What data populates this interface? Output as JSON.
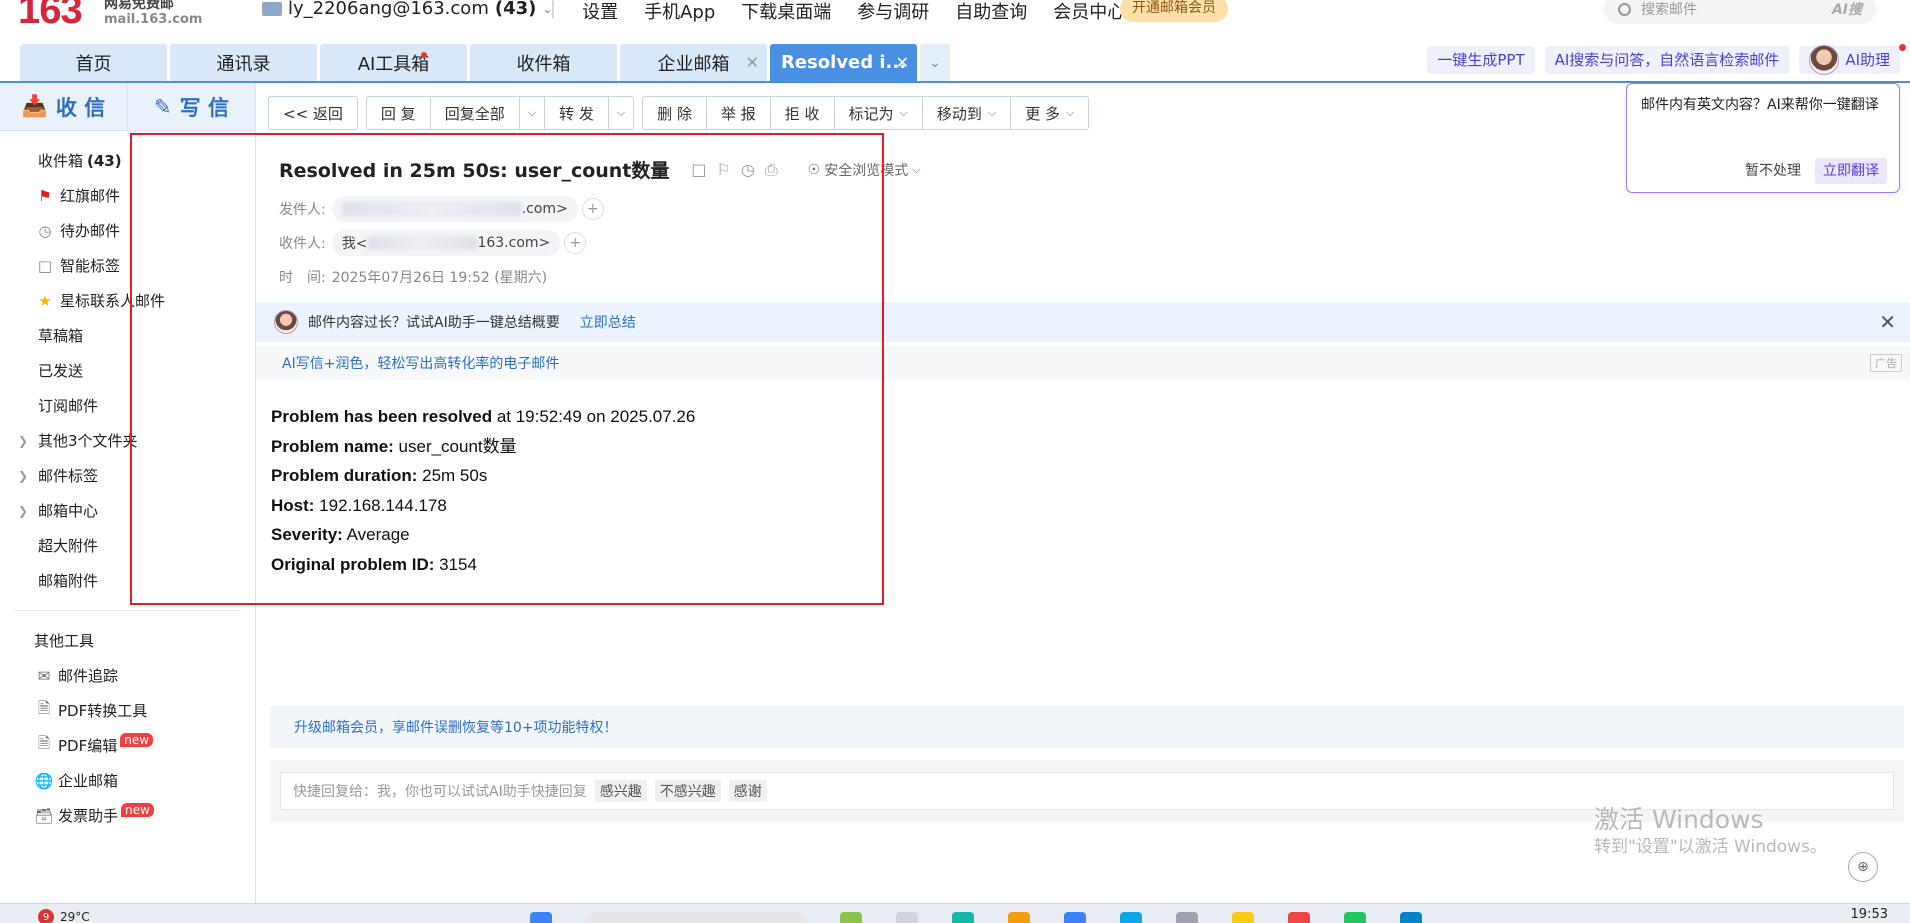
{
  "header": {
    "logo_number": "163",
    "logo_brand": "网易免费邮",
    "logo_domain": "mail.163.com",
    "account": "ly_2206ang@163.com",
    "account_count": "(43)",
    "nav": [
      "设置",
      "手机App",
      "下载桌面端",
      "参与调研",
      "自助查询",
      "会员中心"
    ],
    "vip_button": "开通邮箱会员",
    "search_placeholder": "搜索邮件",
    "search_ai": "AI搜"
  },
  "tabs": [
    {
      "label": "首页"
    },
    {
      "label": "通讯录"
    },
    {
      "label": "AI工具箱"
    },
    {
      "label": "收件箱"
    },
    {
      "label": "企业邮箱"
    },
    {
      "label": "Resolved i..."
    }
  ],
  "right_pills": [
    "一键生成PPT",
    "AI搜索与问答，自然语言检索邮件"
  ],
  "ai_helper_label": "AI助理",
  "sidebar": {
    "receive": "收 信",
    "write": "写 信",
    "inbox_label": "收件箱",
    "inbox_count": "(43)",
    "items": [
      "红旗邮件",
      "待办邮件",
      "智能标签",
      "星标联系人邮件",
      "草稿箱",
      "已发送",
      "订阅邮件",
      "其他3个文件夹",
      "邮件标签",
      "邮箱中心",
      "超大附件",
      "邮箱附件"
    ],
    "tools_title": "其他工具",
    "tools": [
      "邮件追踪",
      "PDF转换工具",
      "PDF编辑",
      "企业邮箱",
      "发票助手"
    ],
    "new_badge": "new"
  },
  "toolbar": {
    "back": "<< 返回",
    "reply": "回 复",
    "reply_all": "回复全部",
    "forward": "转 发",
    "delete": "删 除",
    "report": "举 报",
    "reject": "拒 收",
    "mark_as": "标记为",
    "move_to": "移动到",
    "more": "更 多"
  },
  "mail": {
    "subject": "Resolved in 25m 50s: user_count数量",
    "safe_mode": "安全浏览模式",
    "from_label": "发件人:",
    "from_suffix": ".com>",
    "to_label": "收件人:",
    "to_prefix": "我<",
    "to_suffix": "163.com>",
    "time_label": "时　间:",
    "time_value": "2025年07月26日 19:52 (星期六)",
    "ai_summary_prompt": "邮件内容过长？试试AI助手一键总结概要",
    "ai_summary_link": "立即总结",
    "ad_text": "AI写信+润色，轻松写出高转化率的电子邮件",
    "ad_tag": "广告",
    "body": {
      "line1_bold": "Problem has been resolved",
      "line1_rest": " at 19:52:49 on 2025.07.26",
      "line2_bold": "Problem name:",
      "line2_rest": " user_count数量",
      "line3_bold": "Problem duration:",
      "line3_rest": " 25m 50s",
      "line4_bold": "Host:",
      "line4_rest": " 192.168.144.178",
      "line5_bold": "Severity:",
      "line5_rest": " Average",
      "line6_bold": "Original problem ID:",
      "line6_rest": " 3154"
    }
  },
  "upgrade_text": "升级邮箱会员，享邮件误删恢复等10+项功能特权！",
  "quick_reply": {
    "placeholder": "快捷回复给：我，你也可以试试AI助手快捷回复",
    "chips": [
      "感兴趣",
      "不感兴趣",
      "感谢"
    ]
  },
  "translate_popup": {
    "text": "邮件内有英文内容？AI来帮你一键翻译",
    "ignore": "暂不处理",
    "translate": "立即翻译"
  },
  "watermark": {
    "line1": "激活 Windows",
    "line2": "转到\"设置\"以激活 Windows。"
  },
  "taskbar": {
    "weather_badge": "9",
    "temperature": "29°C",
    "time": "19:53"
  }
}
